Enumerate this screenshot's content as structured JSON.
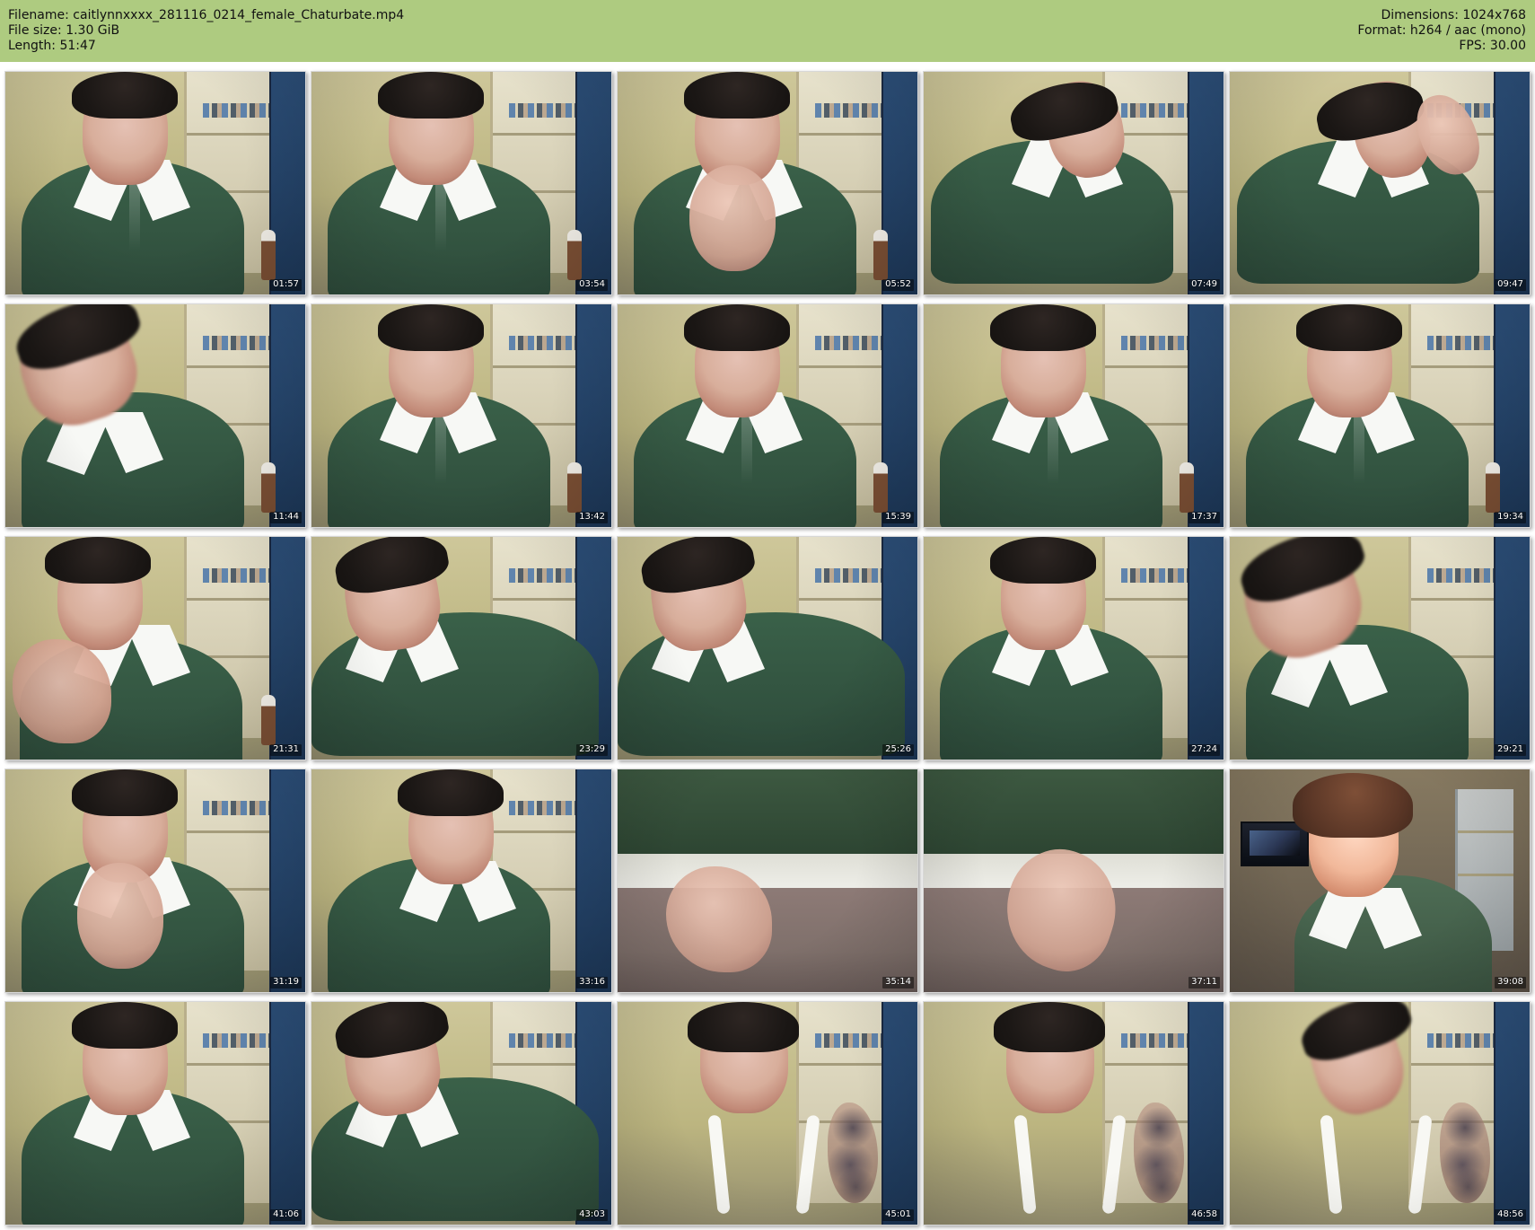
{
  "header": {
    "left": {
      "filename": "Filename: caitlynnxxxx_281116_0214_female_Chaturbate.mp4",
      "file_size": "File size: 1.30 GiB",
      "length": "Length: 51:47"
    },
    "right": {
      "dimensions": "Dimensions: 1024x768",
      "format": "Format: h264 / aac (mono)",
      "fps": "FPS: 30.00"
    }
  },
  "thumbnails": [
    {
      "time": "01:57"
    },
    {
      "time": "03:54"
    },
    {
      "time": "05:52"
    },
    {
      "time": "07:49"
    },
    {
      "time": "09:47"
    },
    {
      "time": "11:44"
    },
    {
      "time": "13:42"
    },
    {
      "time": "15:39"
    },
    {
      "time": "17:37"
    },
    {
      "time": "19:34"
    },
    {
      "time": "21:31"
    },
    {
      "time": "23:29"
    },
    {
      "time": "25:26"
    },
    {
      "time": "27:24"
    },
    {
      "time": "29:21"
    },
    {
      "time": "31:19"
    },
    {
      "time": "33:16"
    },
    {
      "time": "35:14"
    },
    {
      "time": "37:11"
    },
    {
      "time": "39:08"
    },
    {
      "time": "41:06"
    },
    {
      "time": "43:03"
    },
    {
      "time": "45:01"
    },
    {
      "time": "46:58"
    },
    {
      "time": "48:56"
    }
  ]
}
